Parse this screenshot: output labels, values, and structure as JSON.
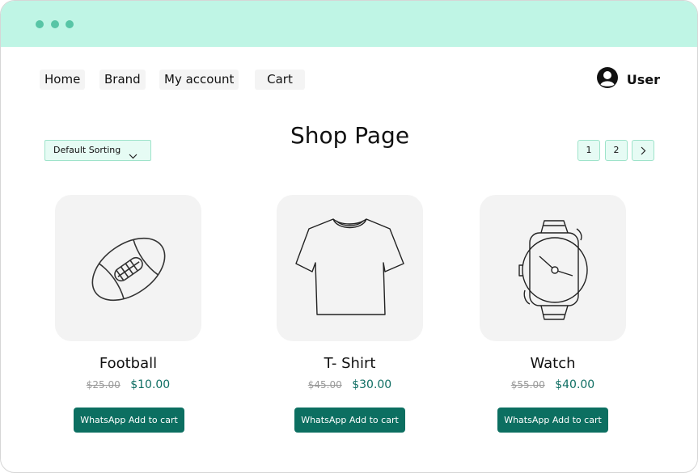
{
  "window": {
    "titlebar_color": "#bff5e5",
    "dot_color": "#58c5a6"
  },
  "nav": {
    "items": [
      {
        "label": "Home"
      },
      {
        "label": "Brand"
      },
      {
        "label": "My account"
      },
      {
        "label": "Cart"
      }
    ]
  },
  "user": {
    "label": "User",
    "icon": "user-avatar-icon"
  },
  "sort": {
    "selected": "Default Sorting",
    "icon": "chevron-down-icon"
  },
  "page": {
    "title": "Shop Page"
  },
  "pagination": {
    "pages": [
      "1",
      "2"
    ],
    "next_icon": "chevron-right-icon"
  },
  "products": [
    {
      "name": "Football",
      "old_price": "$25.00",
      "price": "$10.00",
      "button": "WhatsApp Add to cart",
      "icon": "football-icon"
    },
    {
      "name": "T- Shirt",
      "old_price": "$45.00",
      "price": "$30.00",
      "button": "WhatsApp Add to cart",
      "icon": "tshirt-icon"
    },
    {
      "name": "Watch",
      "old_price": "$55.00",
      "price": "$40.00",
      "button": "WhatsApp Add to cart",
      "icon": "watch-icon"
    }
  ],
  "colors": {
    "accent": "#0c6f61",
    "price": "#0f6e63",
    "card_bg": "#f3f3f3",
    "chip_bg": "#e6fbf4"
  }
}
